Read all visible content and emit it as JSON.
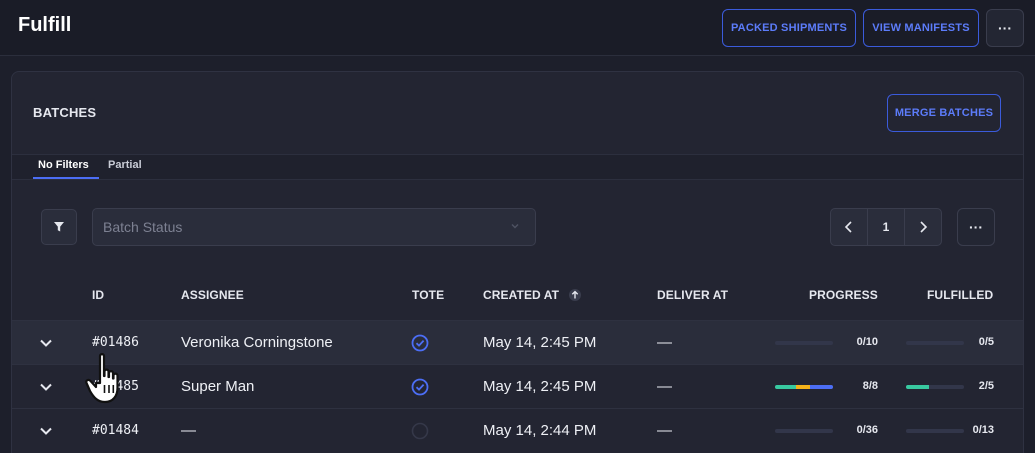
{
  "header": {
    "title": "Fulfill",
    "packed_label": "PACKED SHIPMENTS",
    "manifests_label": "VIEW MANIFESTS",
    "more_label": "···"
  },
  "batches": {
    "title": "BATCHES",
    "merge_label": "MERGE BATCHES",
    "tabs": [
      {
        "label": "No Filters",
        "active": true
      },
      {
        "label": "Partial",
        "active": false
      }
    ],
    "status_placeholder": "Batch Status",
    "page": "1",
    "more_label": "···"
  },
  "table": {
    "columns": {
      "id": "ID",
      "assignee": "ASSIGNEE",
      "tote": "TOTE",
      "created_at": "CREATED AT",
      "deliver_at": "DELIVER AT",
      "progress": "PROGRESS",
      "fulfilled": "FULFILLED"
    },
    "rows": [
      {
        "id": "#01486",
        "assignee": "Veronika Corningstone",
        "tote": true,
        "created_at": "May 14, 2:45 PM",
        "deliver_at": "—",
        "progress_label": "0/10",
        "progress_segments": [],
        "fulfilled_label": "0/5",
        "fulfilled_fraction": 0
      },
      {
        "id": "#01485",
        "assignee": "Super Man",
        "tote": true,
        "created_at": "May 14, 2:45 PM",
        "deliver_at": "—",
        "progress_label": "8/8",
        "progress_segments": [
          {
            "fraction": 0.37,
            "color": "#38c9a0"
          },
          {
            "fraction": 0.23,
            "color": "#f5b31a"
          },
          {
            "fraction": 0.4,
            "color": "#4c6ef5"
          }
        ],
        "fulfilled_label": "2/5",
        "fulfilled_fraction": 0.4
      },
      {
        "id": "#01484",
        "assignee": "—",
        "tote": false,
        "created_at": "May 14, 2:44 PM",
        "deliver_at": "—",
        "progress_label": "0/36",
        "progress_segments": [],
        "fulfilled_label": "0/13",
        "fulfilled_fraction": 0
      }
    ]
  },
  "colors": {
    "accent": "#4c6ef5",
    "fulfilled": "#38c9a0",
    "background": "#1d1f2b"
  }
}
